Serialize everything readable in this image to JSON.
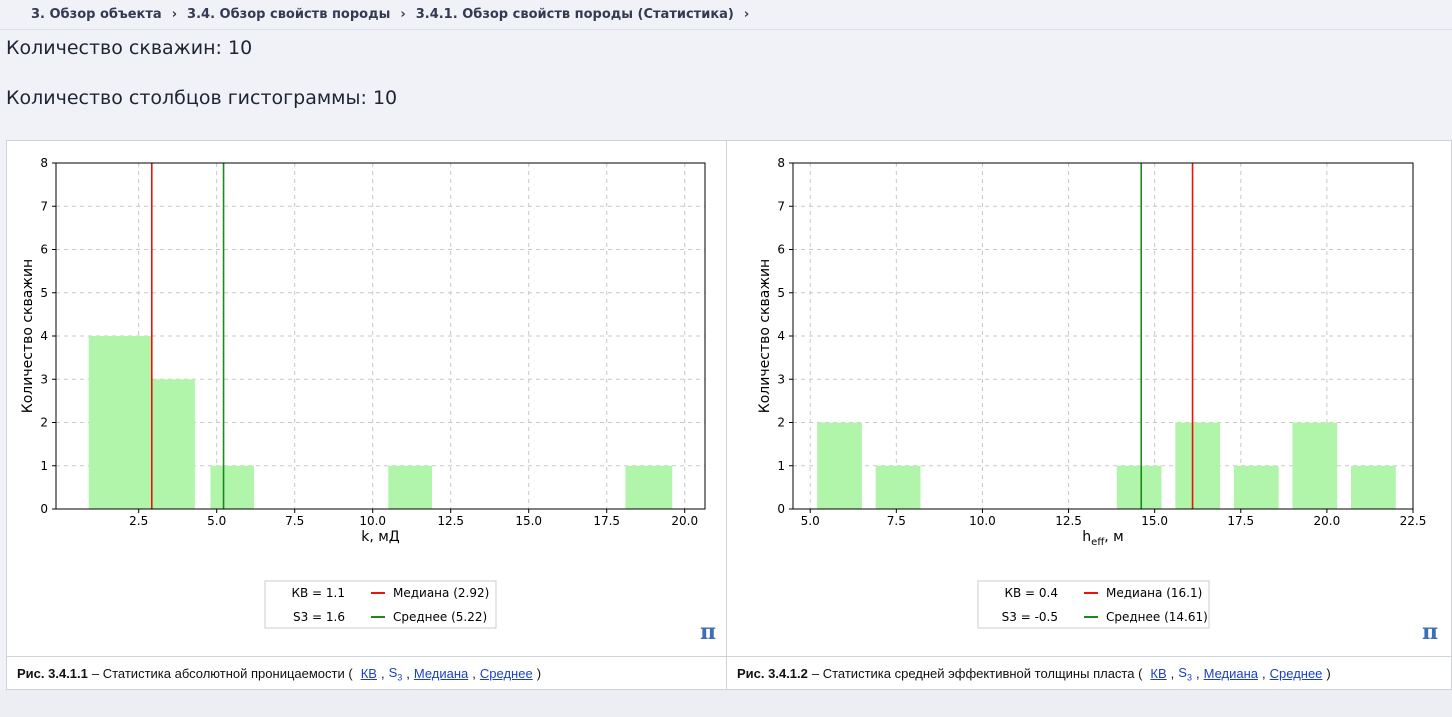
{
  "breadcrumb": {
    "items": [
      "3. Обзор объекта",
      "3.4. Обзор свойств породы",
      "3.4.1. Обзор свойств породы (Статистика)"
    ],
    "sep": "›"
  },
  "stats": {
    "wells": "Количество скважин: 10",
    "bins": "Количество столбцов гистограммы: 10"
  },
  "chart_data": [
    {
      "type": "bar",
      "ylabel": "Количество скважин",
      "xlabel": "k, мД",
      "ylim": [
        0,
        8
      ],
      "xlim": [
        -0.15,
        20.65
      ],
      "xticks": [
        2.5,
        5.0,
        7.5,
        10.0,
        12.5,
        15.0,
        17.5,
        20.0
      ],
      "xtick_labels": [
        "2.5",
        "5.0",
        "7.5",
        "10.0",
        "12.5",
        "15.0",
        "17.5",
        "20.0"
      ],
      "yticks": [
        0,
        1,
        2,
        3,
        4,
        5,
        6,
        7,
        8
      ],
      "bins": [
        {
          "left": 0.9,
          "right": 2.9,
          "value": 4
        },
        {
          "left": 2.9,
          "right": 4.3,
          "value": 3
        },
        {
          "left": 4.8,
          "right": 6.2,
          "value": 1
        },
        {
          "left": 10.5,
          "right": 11.9,
          "value": 1
        },
        {
          "left": 18.1,
          "right": 19.6,
          "value": 1
        }
      ],
      "median": 2.92,
      "mean": 5.22,
      "grid": true,
      "legend": {
        "kv": "КВ = 1.1",
        "s3": "S3 = 1.6",
        "median_label": "Медиана (2.92)",
        "mean_label": "Среднее (5.22)"
      }
    },
    {
      "type": "bar",
      "ylabel": "Количество скважин",
      "xlabel_main": "h",
      "xlabel_sub": "eff",
      "xlabel_unit": ", м",
      "ylim": [
        0,
        8
      ],
      "xlim": [
        4.5,
        22.5
      ],
      "xticks": [
        5.0,
        7.5,
        10.0,
        12.5,
        15.0,
        17.5,
        20.0,
        22.5
      ],
      "xtick_labels": [
        "5.0",
        "7.5",
        "10.0",
        "12.5",
        "15.0",
        "17.5",
        "20.0",
        "22.5"
      ],
      "yticks": [
        0,
        1,
        2,
        3,
        4,
        5,
        6,
        7,
        8
      ],
      "bins": [
        {
          "left": 5.2,
          "right": 6.5,
          "value": 2
        },
        {
          "left": 6.9,
          "right": 8.2,
          "value": 1
        },
        {
          "left": 13.9,
          "right": 15.2,
          "value": 1
        },
        {
          "left": 15.6,
          "right": 16.9,
          "value": 2
        },
        {
          "left": 17.3,
          "right": 18.6,
          "value": 1
        },
        {
          "left": 19.0,
          "right": 20.3,
          "value": 2
        },
        {
          "left": 20.7,
          "right": 22.0,
          "value": 1
        }
      ],
      "median": 16.1,
      "mean": 14.61,
      "grid": true,
      "legend": {
        "kv": "КВ = 0.4",
        "s3": "S3 = -0.5",
        "median_label": "Медиана (16.1)",
        "mean_label": "Среднее (14.61)"
      }
    }
  ],
  "colors": {
    "bar": "#b0f5a9",
    "median": "#e8140c",
    "mean": "#1b8a1b",
    "grid": "#c8c8c8"
  },
  "captions": [
    {
      "fig": "Рис. 3.4.1.1",
      "text": "– Статистика абсолютной проницаемости (",
      "kv": "КВ",
      "s3": "S",
      "s3_sub": "3",
      "median": "Медиана",
      "mean": "Среднее",
      "comma": ",",
      "close": ")"
    },
    {
      "fig": "Рис. 3.4.1.2",
      "text": "– Статистика средней эффективной толщины пласта (",
      "kv": "КВ",
      "s3": "S",
      "s3_sub": "3",
      "median": "Медиана",
      "mean": "Среднее",
      "comma": ",",
      "close": ")"
    }
  ],
  "icons": {
    "pi": "π"
  }
}
